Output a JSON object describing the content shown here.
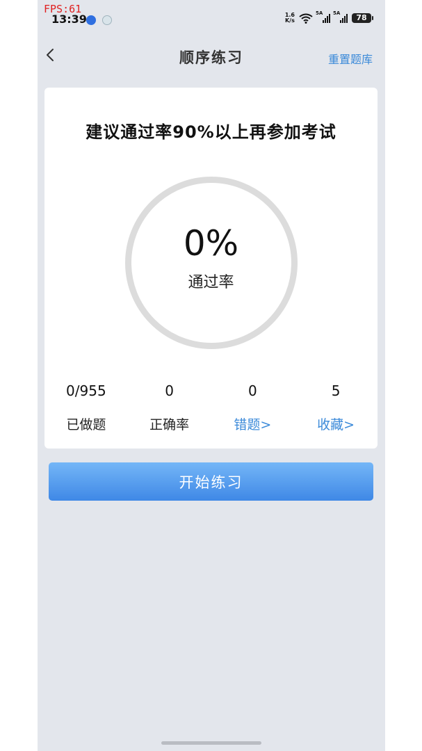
{
  "overlay": {
    "fps": "FPS:61"
  },
  "status_bar": {
    "time": "13:39",
    "net_speed_value": "1.6",
    "net_speed_unit": "K/s",
    "signal1_tag": "5A",
    "signal2_tag": "5A",
    "battery": "78"
  },
  "nav": {
    "title": "顺序练习",
    "reset_label": "重置题库"
  },
  "card": {
    "advice": "建议通过率90%以上再参加考试",
    "pass_rate_value": "0%",
    "pass_rate_label": "通过率",
    "stats": [
      {
        "value": "0/955",
        "label": "已做题"
      },
      {
        "value": "0",
        "label": "正确率"
      },
      {
        "value": "0",
        "label": "错题>"
      },
      {
        "value": "5",
        "label": "收藏>"
      }
    ]
  },
  "start_button": {
    "label": "开始练习"
  },
  "colors": {
    "accent": "#3b8ad9",
    "button_top": "#74b6f7",
    "button_bottom": "#3f88e6",
    "background": "#e3e6ec",
    "ring": "#dcdcdc"
  },
  "icons": {
    "back": "chevron-left-icon",
    "wifi": "wifi-icon",
    "signal": "signal-icon",
    "battery": "battery-icon"
  }
}
